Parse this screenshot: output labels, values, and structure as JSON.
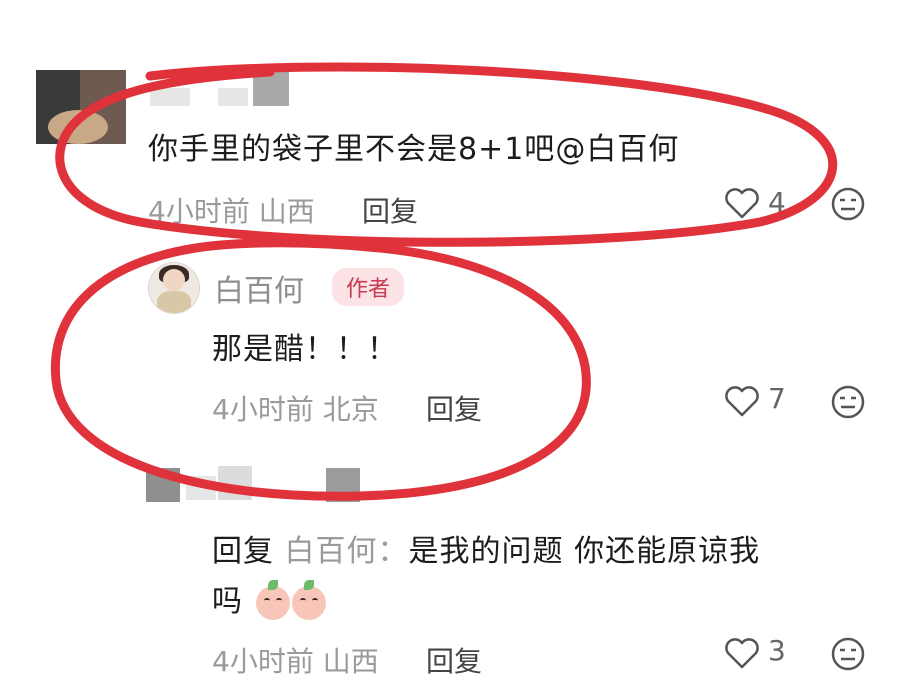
{
  "comments": [
    {
      "text_main": "你手里的袋子里不会是8+1吧",
      "mention": "@白百何",
      "time": "4小时前",
      "location": "山西",
      "reply_label": "回复",
      "likes": "4"
    },
    {
      "username": "白百何",
      "badge": "作者",
      "text": "那是醋！！！",
      "time": "4小时前",
      "location": "北京",
      "reply_label": "回复",
      "likes": "7"
    },
    {
      "reply_prefix": "回复",
      "reply_to": "白百何：",
      "text_line1": "是我的问题 你还能原谅我",
      "text_line2": "吗",
      "time": "4小时前",
      "location": "山西",
      "reply_label": "回复",
      "likes": "3"
    }
  ],
  "colors": {
    "annotation_circle": "#e0323a",
    "author_badge": "#c63b4f"
  }
}
